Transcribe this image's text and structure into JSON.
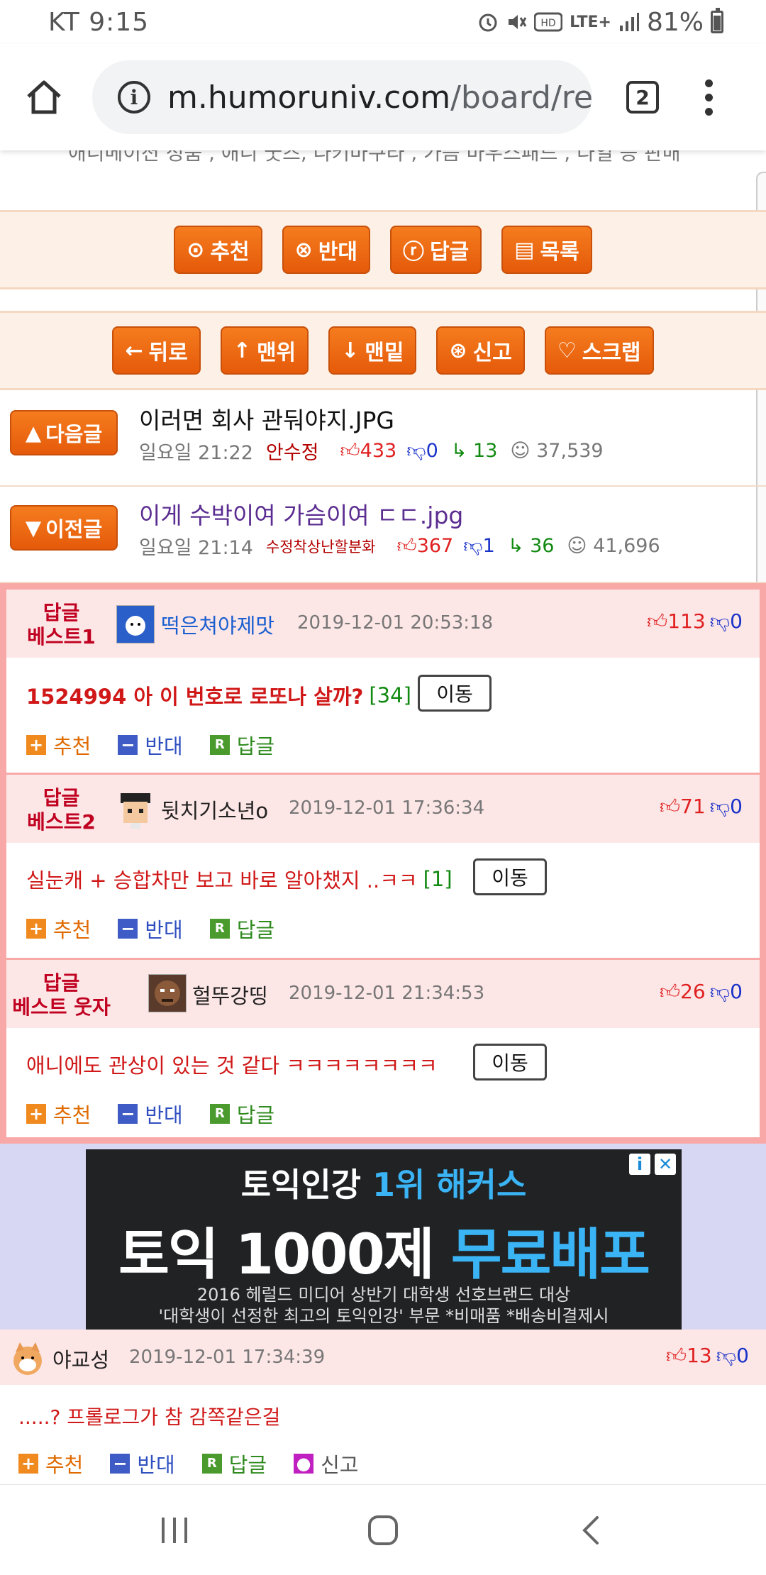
{
  "status": {
    "carrier_time": "KT 9:15",
    "battery": "81%",
    "network": "LTE+"
  },
  "browser": {
    "url_host": "m.humoruniv.com",
    "url_path": "/board/re",
    "tab_count": "2"
  },
  "top_cut_text": "애니메이션 정품 , 애니 굿즈, 다키마쿠라 , 가슴 마우스패드 , 다일 등 판매",
  "actions_top": [
    "추천",
    "반대",
    "답글",
    "목록"
  ],
  "actions_nav": [
    "뒤로",
    "맨위",
    "맨밑",
    "신고",
    "스크랩"
  ],
  "next_post": {
    "label": "다음글",
    "title": "이러면 회사 관둬야지.JPG",
    "time": "일요일 21:22",
    "author": "안수정",
    "up": "433",
    "down": "0",
    "replies": "13",
    "views": "37,539"
  },
  "prev_post": {
    "label": "이전글",
    "title": "이게 수박이여 가슴이여 ㄷㄷ.jpg",
    "time": "일요일 21:14",
    "author": "수정착상난할분화",
    "up": "367",
    "down": "1",
    "replies": "36",
    "views": "41,696"
  },
  "best_comments": [
    {
      "label1": "답글",
      "label2": "베스트1",
      "user": "떡은쳐야제맛",
      "date": "2019-12-01 20:53:18",
      "up": "113",
      "down": "0",
      "text": "1524994 아 이 번호로 로또나 살까?",
      "count": "[34]",
      "move": "이동"
    },
    {
      "label1": "답글",
      "label2": "베스트2",
      "user": "뒷치기소년o",
      "date": "2019-12-01 17:36:34",
      "up": "71",
      "down": "0",
      "text": "실눈캐 + 승합차만 보고 바로 알아챘지 ..ㅋㅋ",
      "count": "[1]",
      "move": "이동"
    },
    {
      "label1": "답글",
      "label2": "베스트 웃자",
      "user": "헐뚜강띵",
      "date": "2019-12-01 21:34:53",
      "up": "26",
      "down": "0",
      "text": "애니에도 관상이 있는 것 같다 ㅋㅋㅋㅋㅋㅋㅋㅋ",
      "count": "",
      "move": "이동"
    }
  ],
  "comment_actions": {
    "recommend": "추천",
    "oppose": "반대",
    "reply": "답글",
    "report": "신고"
  },
  "ad": {
    "line1a": "토익인강 ",
    "line1b": "1위 해커스",
    "line2a": "토익 1000제 ",
    "line2b": "무료배포",
    "line3": "2016 헤럴드 미디어 상반기 대학생 선호브랜드 대상",
    "line4": "'대학생이 선정한 최고의 토익인강' 부문 *비매품 *배송비결제시"
  },
  "comment": {
    "user": "야교성",
    "date": "2019-12-01 17:34:39",
    "up": "13",
    "down": "0",
    "text": ".....? 프롤로그가 참 감쪽같은걸"
  },
  "colors": {
    "accent_orange": "#f57c1e",
    "best_border": "#f9a8a8",
    "up_red": "#e02020",
    "down_blue": "#1a33c9"
  }
}
